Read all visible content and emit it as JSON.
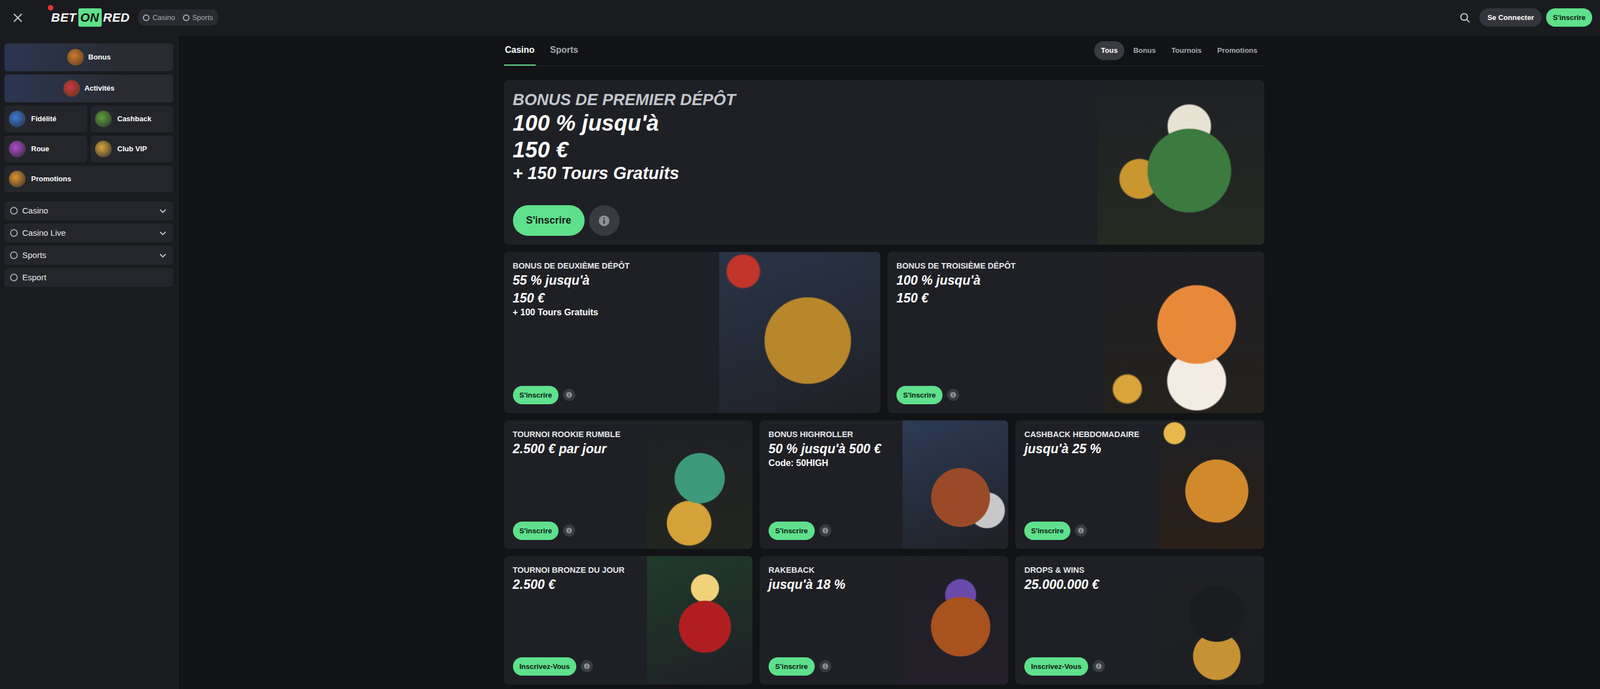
{
  "header": {
    "logo": [
      {
        "text": "BET",
        "boxed": false
      },
      {
        "text": "ON",
        "boxed": true
      },
      {
        "text": "RED",
        "boxed": false
      }
    ],
    "nav": [
      {
        "label": "Casino"
      },
      {
        "label": "Sports"
      }
    ],
    "login": "Se Connecter",
    "signup": "S'inscrire"
  },
  "sidebar": {
    "featured": [
      {
        "label": "Bonus"
      },
      {
        "label": "Activités"
      }
    ],
    "tiles": [
      {
        "label": "Fidélité"
      },
      {
        "label": "Cashback"
      },
      {
        "label": "Roue"
      },
      {
        "label": "Club VIP"
      },
      {
        "label": "Promotions"
      }
    ],
    "sections": [
      {
        "label": "Casino",
        "expandable": true,
        "expanded": false
      },
      {
        "label": "Casino Live",
        "expandable": true,
        "expanded": false
      },
      {
        "label": "Sports",
        "expandable": true,
        "expanded": false
      },
      {
        "label": "Esport",
        "expandable": false,
        "expanded": false
      }
    ]
  },
  "tabs": [
    {
      "label": "Casino",
      "selected": true
    },
    {
      "label": "Sports",
      "selected": false
    }
  ],
  "filters": [
    {
      "label": "Tous",
      "selected": true
    },
    {
      "label": "Bonus",
      "selected": false
    },
    {
      "label": "Tournois",
      "selected": false
    },
    {
      "label": "Promotions",
      "selected": false
    }
  ],
  "hero": {
    "title": "BONUS DE PREMIER DÉPÔT",
    "lines": [
      "100 % jusqu'à",
      "150 €"
    ],
    "sub": "+ 150 Tours Gratuits",
    "button": "S'inscrire"
  },
  "promos": [
    {
      "title": "BONUS DE DEUXIÈME DÉPÔT",
      "lines": [
        "55 % jusqu'à",
        "150 €"
      ],
      "sub": "+ 100 Tours Gratuits",
      "button": "S'inscrire"
    },
    {
      "title": "BONUS DE TROISIÈME DÉPÔT",
      "lines": [
        "100 % jusqu'à",
        "150 €"
      ],
      "sub": "",
      "button": "S'inscrire"
    },
    {
      "title": "TOURNOI ROOKIE RUMBLE",
      "lines": [
        "2.500 € par jour"
      ],
      "sub": "",
      "button": "S'inscrire"
    },
    {
      "title": "BONUS HIGHROLLER",
      "lines": [
        "50 % jusqu'à 500 €"
      ],
      "sub": "Code: 50HIGH",
      "button": "S'inscrire"
    },
    {
      "title": "CASHBACK HEBDOMADAIRE",
      "lines": [
        "jusqu'à 25 %"
      ],
      "sub": "",
      "button": "S'inscrire"
    },
    {
      "title": "TOURNOI BRONZE DU JOUR",
      "lines": [
        "2.500 €"
      ],
      "sub": "",
      "button": "Inscrivez-Vous"
    },
    {
      "title": "RAKEBACK",
      "lines": [
        "jusqu'à 18 %"
      ],
      "sub": "",
      "button": "S'inscrire"
    },
    {
      "title": "DROPS & WINS",
      "lines": [
        "25.000.000 €"
      ],
      "sub": "",
      "button": "Inscrivez-Vous"
    }
  ]
}
